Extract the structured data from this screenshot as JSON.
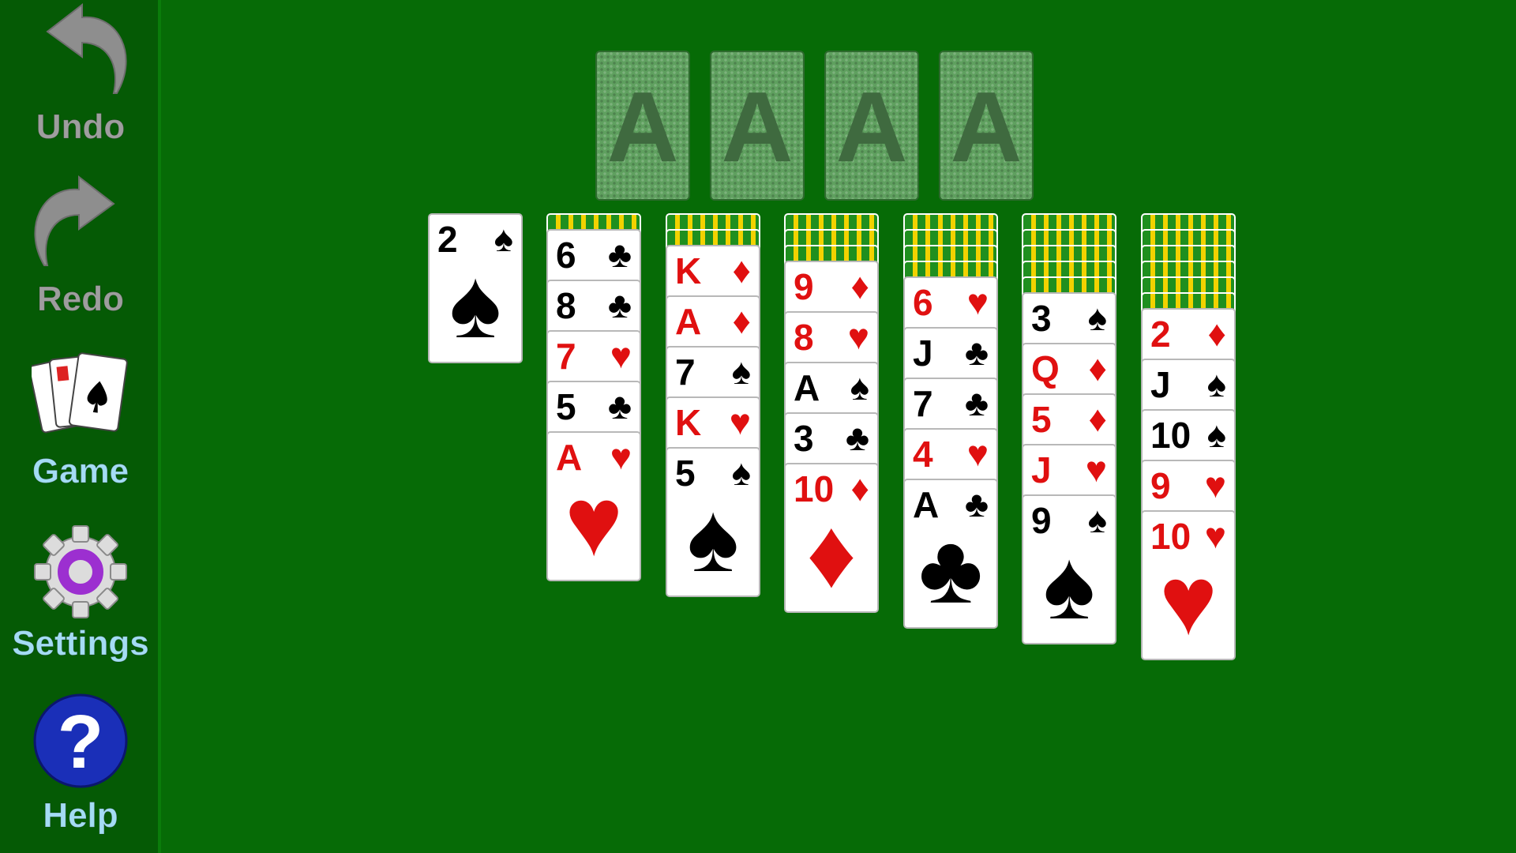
{
  "sidebar": {
    "undo": {
      "label": "Undo"
    },
    "redo": {
      "label": "Redo"
    },
    "game": {
      "label": "Game"
    },
    "settings": {
      "label": "Settings"
    },
    "help": {
      "label": "Help"
    }
  },
  "foundations": [
    {
      "label": "A"
    },
    {
      "label": "A"
    },
    {
      "label": "A"
    },
    {
      "label": "A"
    }
  ],
  "stock": {
    "rank": "2",
    "suit": "♠",
    "color": "black"
  },
  "tableau": [
    {
      "hidden": 1,
      "cards": [
        {
          "rank": "6",
          "suit": "♣",
          "color": "black"
        },
        {
          "rank": "8",
          "suit": "♣",
          "color": "black"
        },
        {
          "rank": "7",
          "suit": "♥",
          "color": "red"
        },
        {
          "rank": "5",
          "suit": "♣",
          "color": "black"
        },
        {
          "rank": "A",
          "suit": "♥",
          "color": "red"
        }
      ]
    },
    {
      "hidden": 2,
      "cards": [
        {
          "rank": "K",
          "suit": "♦",
          "color": "red"
        },
        {
          "rank": "A",
          "suit": "♦",
          "color": "red"
        },
        {
          "rank": "7",
          "suit": "♠",
          "color": "black"
        },
        {
          "rank": "K",
          "suit": "♥",
          "color": "red"
        },
        {
          "rank": "5",
          "suit": "♠",
          "color": "black"
        }
      ]
    },
    {
      "hidden": 3,
      "cards": [
        {
          "rank": "9",
          "suit": "♦",
          "color": "red"
        },
        {
          "rank": "8",
          "suit": "♥",
          "color": "red"
        },
        {
          "rank": "A",
          "suit": "♠",
          "color": "black"
        },
        {
          "rank": "3",
          "suit": "♣",
          "color": "black"
        },
        {
          "rank": "10",
          "suit": "♦",
          "color": "red"
        }
      ]
    },
    {
      "hidden": 4,
      "cards": [
        {
          "rank": "6",
          "suit": "♥",
          "color": "red"
        },
        {
          "rank": "J",
          "suit": "♣",
          "color": "black"
        },
        {
          "rank": "7",
          "suit": "♣",
          "color": "black"
        },
        {
          "rank": "4",
          "suit": "♥",
          "color": "red"
        },
        {
          "rank": "A",
          "suit": "♣",
          "color": "black"
        }
      ]
    },
    {
      "hidden": 5,
      "cards": [
        {
          "rank": "3",
          "suit": "♠",
          "color": "black"
        },
        {
          "rank": "Q",
          "suit": "♦",
          "color": "red"
        },
        {
          "rank": "5",
          "suit": "♦",
          "color": "red"
        },
        {
          "rank": "J",
          "suit": "♥",
          "color": "red"
        },
        {
          "rank": "9",
          "suit": "♠",
          "color": "black"
        }
      ]
    },
    {
      "hidden": 6,
      "cards": [
        {
          "rank": "2",
          "suit": "♦",
          "color": "red"
        },
        {
          "rank": "J",
          "suit": "♠",
          "color": "black"
        },
        {
          "rank": "10",
          "suit": "♠",
          "color": "black"
        },
        {
          "rank": "9",
          "suit": "♥",
          "color": "red"
        },
        {
          "rank": "10",
          "suit": "♥",
          "color": "red"
        }
      ]
    }
  ]
}
